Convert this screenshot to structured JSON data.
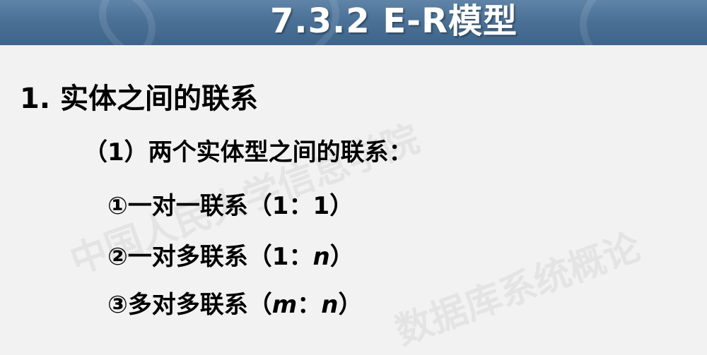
{
  "slide": {
    "title": "7.3.2  E-R模型",
    "heading": "1. 实体之间的联系",
    "subheading": "（1）两个实体型之间的联系：",
    "items": [
      {
        "prefix": "①一对一联系（",
        "a": "1",
        "sep": "：",
        "b": "1",
        "suffix": "）"
      },
      {
        "prefix": "②一对多联系（",
        "a": "1",
        "sep": "：",
        "b": "n",
        "suffix": "）"
      },
      {
        "prefix": "③多对多联系（",
        "a": "m",
        "sep": "：",
        "b": "n",
        "suffix": "）"
      }
    ],
    "watermarks": [
      "中国人民大学信息学院",
      "数据库系统概论"
    ]
  },
  "colors": {
    "header_top": "#5f84a8",
    "header_bottom": "#3f6489",
    "background": "#f2f2f2",
    "text": "#000000",
    "title_text": "#ffffff"
  }
}
